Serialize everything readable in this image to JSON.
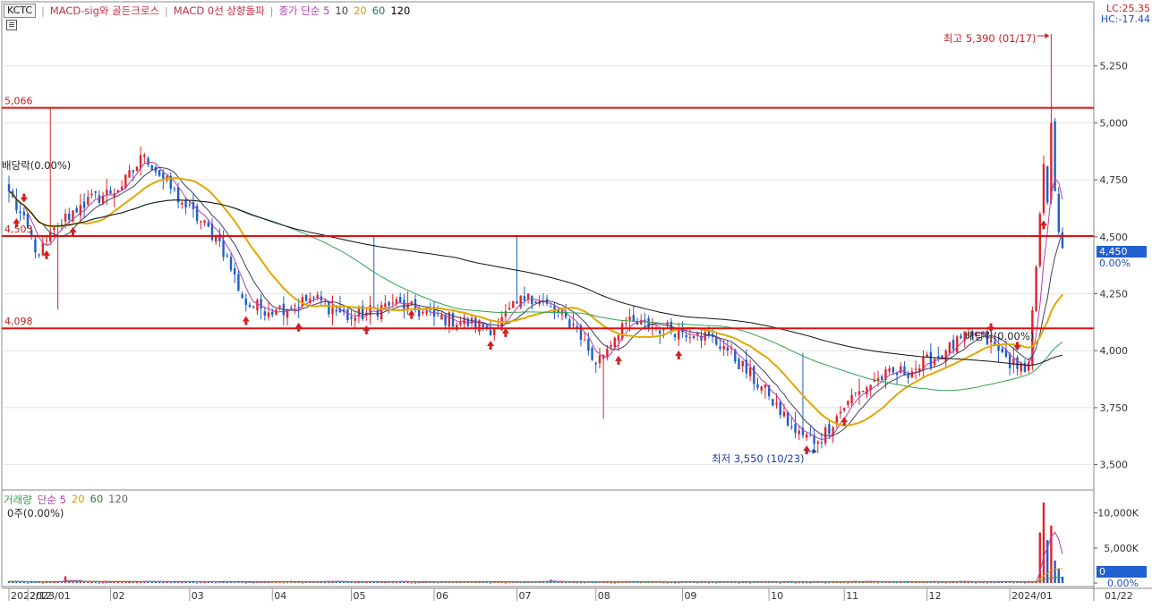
{
  "ticker": "KCTC",
  "legend": {
    "items": [
      {
        "label": "MACD-sig와 골든크로스",
        "color": "#c03048"
      },
      {
        "label": "MACD 0선 상향돌파",
        "color": "#c03048"
      },
      {
        "label": "종가 단순 5",
        "color": "#b040b0"
      },
      {
        "label": "10",
        "color": "#404040"
      },
      {
        "label": "20",
        "color": "#d4a000"
      },
      {
        "label": "60",
        "color": "#208040"
      },
      {
        "label": "120",
        "color": "#000000"
      }
    ]
  },
  "top_right": {
    "lc": "LC:25.35",
    "hc": "HC:-17.44"
  },
  "annotations": {
    "high": "최고 5,390 (01/17)",
    "low": "최저 3,550 (10/23)",
    "dividend1": "배당락(0.00%)",
    "dividend2": "배당락(0.00%)"
  },
  "price_box": {
    "price": "4,450",
    "pct": "0.00%"
  },
  "volume_legend": {
    "title": "거래량",
    "ma_label": "단순 5",
    "periods": [
      "20",
      "60",
      "120"
    ],
    "sub": "0주(0.00%)"
  },
  "volume_box": {
    "value": "0",
    "pct": "0.00%"
  },
  "colors": {
    "up": "#e0242a",
    "down": "#1e5ec8",
    "hline": "#e01010",
    "ma5": "#b040b0",
    "ma10": "#404060",
    "ma20": "#e0a800",
    "ma60": "#30a050",
    "ma120": "#111111",
    "grid": "#e4e4e4",
    "border": "#8a8a8a"
  },
  "chart_data": {
    "type": "candlestick",
    "y_ticks": [
      "5,250",
      "5,000",
      "4,750",
      "4,500",
      "4,250",
      "4,000",
      "3,750",
      "3,500"
    ],
    "y_tick_values": [
      5250,
      5000,
      4750,
      4500,
      4250,
      4000,
      3750,
      3500
    ],
    "ylim": [
      3420,
      5500
    ],
    "horizontal_lines": [
      {
        "value": 5066,
        "label": "5,066"
      },
      {
        "value": 4503,
        "label": "4,503"
      },
      {
        "value": 4098,
        "label": "4,098"
      }
    ],
    "x_labels": [
      "2022/12",
      "2023/01",
      "02",
      "03",
      "04",
      "05",
      "06",
      "07",
      "08",
      "09",
      "10",
      "11",
      "12",
      "2024/01",
      "01/22"
    ],
    "x_label_dates": [
      "2022-12-26",
      "2023-01-02",
      "2023-02-01",
      "2023-03-02",
      "2023-04-03",
      "2023-05-02",
      "2023-06-01",
      "2023-07-03",
      "2023-08-01",
      "2023-09-01",
      "2023-10-04",
      "2023-11-01",
      "2023-12-01",
      "2024-01-02",
      "2024-01-22"
    ],
    "price_anchors": [
      {
        "date": "2022-12-26",
        "close": 4700
      },
      {
        "date": "2023-01-05",
        "close": 4420
      },
      {
        "date": "2023-01-12",
        "close": 4550
      },
      {
        "date": "2023-01-20",
        "close": 4640
      },
      {
        "date": "2023-02-06",
        "close": 4720
      },
      {
        "date": "2023-02-14",
        "close": 4860
      },
      {
        "date": "2023-02-28",
        "close": 4650
      },
      {
        "date": "2023-03-14",
        "close": 4480
      },
      {
        "date": "2023-03-23",
        "close": 4200
      },
      {
        "date": "2023-04-04",
        "close": 4180
      },
      {
        "date": "2023-04-18",
        "close": 4230
      },
      {
        "date": "2023-05-02",
        "close": 4140
      },
      {
        "date": "2023-05-17",
        "close": 4210
      },
      {
        "date": "2023-06-01",
        "close": 4150
      },
      {
        "date": "2023-06-23",
        "close": 4100
      },
      {
        "date": "2023-07-06",
        "close": 4250
      },
      {
        "date": "2023-07-25",
        "close": 4100
      },
      {
        "date": "2023-08-01",
        "close": 3940
      },
      {
        "date": "2023-08-10",
        "close": 4120
      },
      {
        "date": "2023-08-25",
        "close": 4100
      },
      {
        "date": "2023-09-07",
        "close": 4080
      },
      {
        "date": "2023-09-18",
        "close": 4020
      },
      {
        "date": "2023-10-04",
        "close": 3800
      },
      {
        "date": "2023-10-13",
        "close": 3640
      },
      {
        "date": "2023-10-23",
        "close": 3600
      },
      {
        "date": "2023-11-02",
        "close": 3780
      },
      {
        "date": "2023-11-14",
        "close": 3880
      },
      {
        "date": "2023-11-28",
        "close": 3920
      },
      {
        "date": "2023-12-08",
        "close": 4000
      },
      {
        "date": "2023-12-20",
        "close": 4080
      },
      {
        "date": "2023-12-28",
        "close": 4000
      },
      {
        "date": "2024-01-04",
        "close": 3920
      },
      {
        "date": "2024-01-09",
        "close": 3950
      },
      {
        "date": "2024-01-12",
        "close": 4600
      },
      {
        "date": "2024-01-15",
        "close": 4820
      },
      {
        "date": "2024-01-16",
        "close": 4650
      },
      {
        "date": "2024-01-17",
        "close": 5000
      },
      {
        "date": "2024-01-18",
        "close": 4700
      },
      {
        "date": "2024-01-19",
        "close": 4520
      },
      {
        "date": "2024-01-22",
        "close": 4450
      }
    ],
    "high": {
      "value": 5390,
      "date": "2024-01-17"
    },
    "low": {
      "value": 3550,
      "date": "2023-10-23"
    },
    "buy_signal_dates": [
      "2022-12-28",
      "2023-01-09",
      "2023-01-18",
      "2023-03-23",
      "2023-04-12",
      "2023-05-08",
      "2023-05-24",
      "2023-06-22",
      "2023-06-28",
      "2023-08-09",
      "2023-08-31",
      "2023-10-18",
      "2023-11-01",
      "2024-01-15"
    ],
    "sell_signal_dates": [
      "2022-12-30",
      "2023-12-26",
      "2024-01-04"
    ],
    "volume_ticks": [
      "10,000K",
      "5,000K",
      "0.00%"
    ],
    "volume_tick_values": [
      10000,
      5000,
      0
    ],
    "volume_ylim": [
      0,
      12000
    ],
    "volume_spikes": [
      {
        "date": "2023-01-16",
        "value": 950
      },
      {
        "date": "2023-07-14",
        "value": 450
      },
      {
        "date": "2024-01-12",
        "value": 7200
      },
      {
        "date": "2024-01-15",
        "value": 11500
      },
      {
        "date": "2024-01-16",
        "value": 6100
      },
      {
        "date": "2024-01-17",
        "value": 8200
      },
      {
        "date": "2024-01-18",
        "value": 3200
      },
      {
        "date": "2024-01-19",
        "value": 2100
      },
      {
        "date": "2024-01-22",
        "value": 900
      }
    ],
    "volume_ma5_peak": 4600
  }
}
